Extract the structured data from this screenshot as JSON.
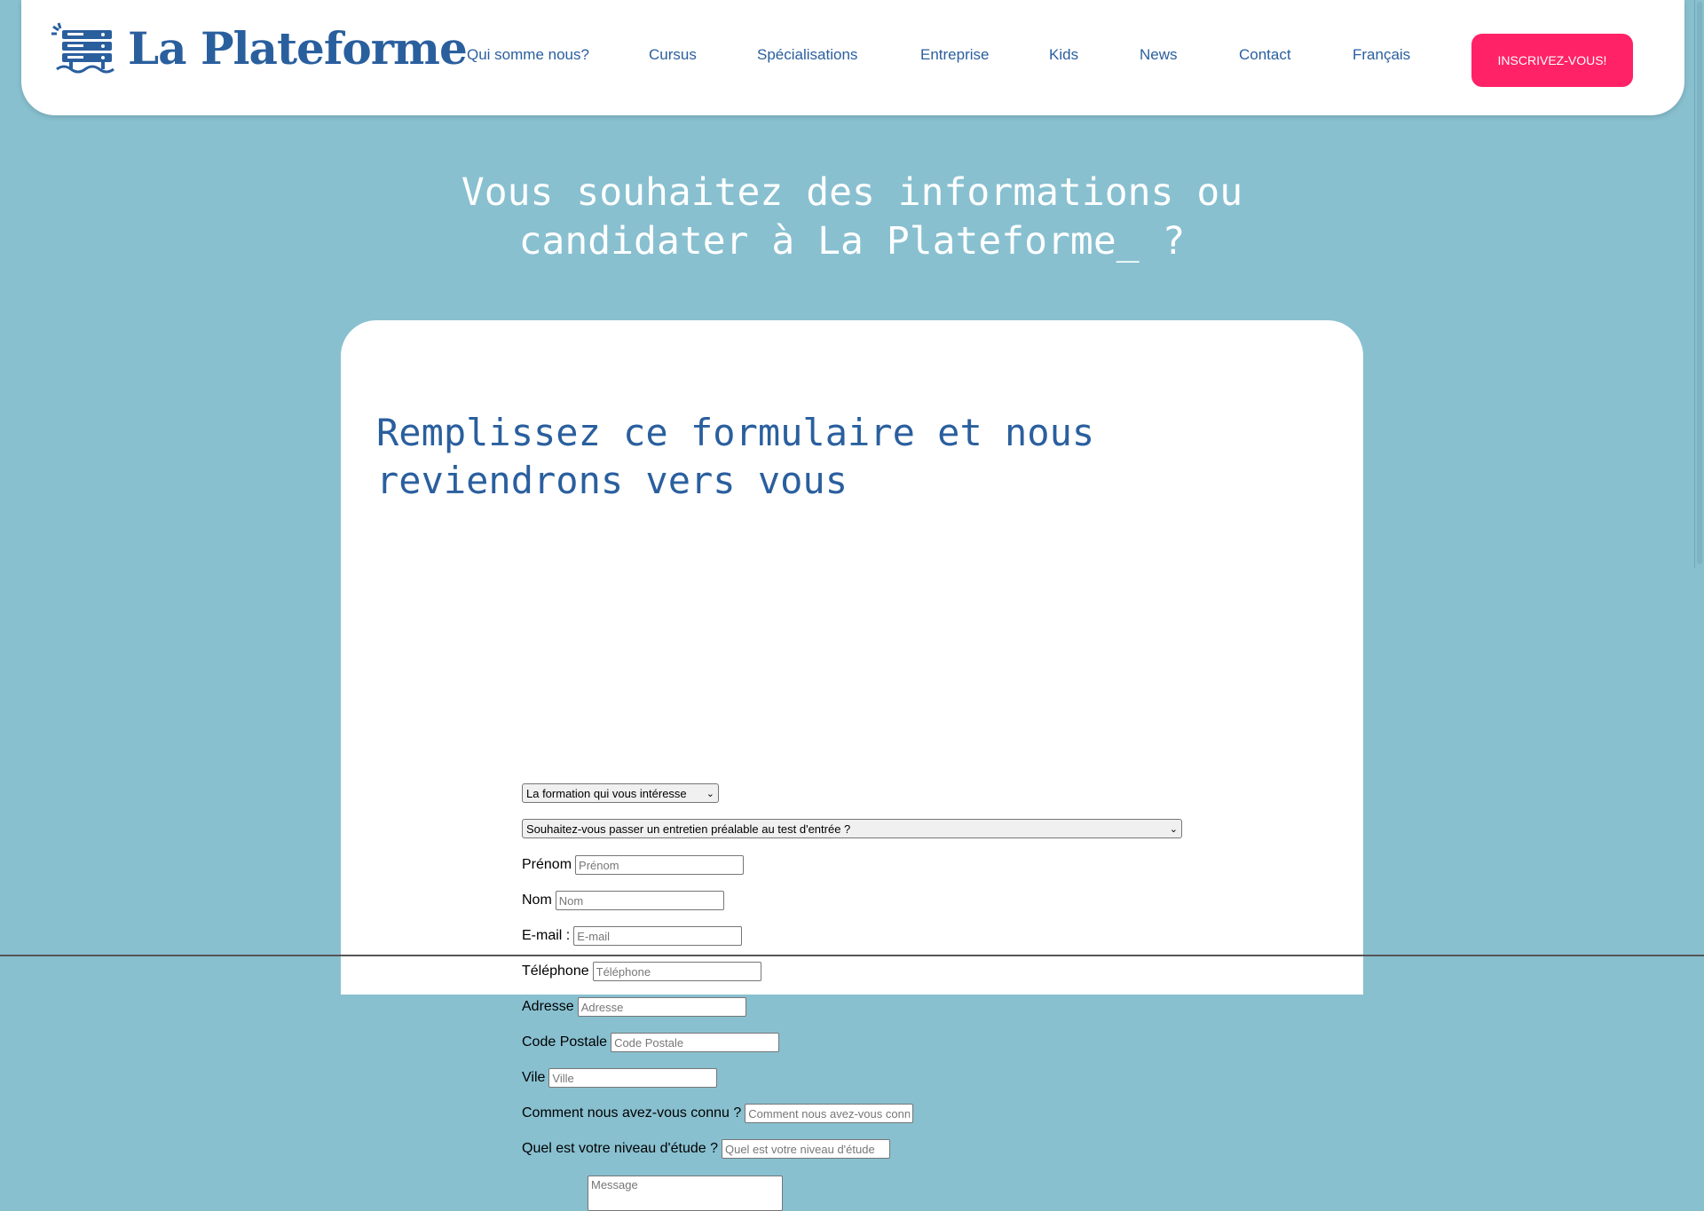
{
  "header": {
    "logo_text": "La Plateforme",
    "nav": [
      {
        "label": "Qui somme nous?"
      },
      {
        "label": "Cursus"
      },
      {
        "label": "Spécialisations"
      },
      {
        "label": "Entreprise"
      },
      {
        "label": "Kids"
      },
      {
        "label": "News"
      },
      {
        "label": "Contact"
      },
      {
        "label": "Français"
      }
    ],
    "cta_label": "INSCRIVEZ-VOUS!"
  },
  "hero": {
    "line1": "Vous souhaitez des informations ou",
    "line2": "candidater à La Plateforme_ ?"
  },
  "form": {
    "title": "Remplissez ce formulaire et nous reviendrons vers vous",
    "formation_select": "La formation qui vous intéresse",
    "entretien_select": "Souhaitez-vous passer un entretien préalable au test d'entrée ?",
    "fields": [
      {
        "label": "Prénom",
        "placeholder": "Prénom"
      },
      {
        "label": "Nom",
        "placeholder": "Nom"
      },
      {
        "label": "E-mail :",
        "placeholder": "E-mail"
      },
      {
        "label": "Téléphone",
        "placeholder": "Téléphone"
      },
      {
        "label": "Adresse",
        "placeholder": "Adresse"
      },
      {
        "label": "Code Postale",
        "placeholder": "Code Postale"
      },
      {
        "label": "Vile",
        "placeholder": "Ville"
      },
      {
        "label": "Comment nous avez-vous connu ?",
        "placeholder": "Comment nous avez-vous connu ?"
      },
      {
        "label": "Quel est votre niveau d'étude ?",
        "placeholder": "Quel est votre niveau d'étude"
      }
    ],
    "message_placeholder": "Message"
  },
  "colors": {
    "background": "#88c0d0",
    "brand_blue": "#2a5f9e",
    "cta_pink": "#ff2266"
  },
  "icons": {
    "logo": "server-rack-logo-icon",
    "select_arrow": "chevron-down-icon"
  }
}
